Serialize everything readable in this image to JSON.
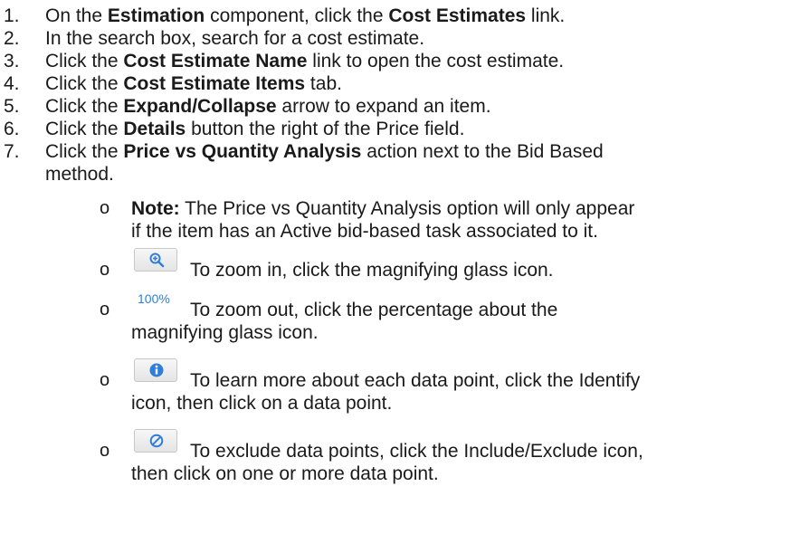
{
  "steps": [
    {
      "num": "1.",
      "parts": [
        "On the ",
        "Estimation",
        " component, click the ",
        "Cost Estimates",
        " link."
      ]
    },
    {
      "num": "2.",
      "text": "In the search box, search for a cost estimate."
    },
    {
      "num": "3.",
      "parts": [
        "Click the ",
        "Cost Estimate Name",
        " link to open the cost estimate."
      ]
    },
    {
      "num": "4.",
      "parts": [
        "Click the ",
        "Cost Estimate Items",
        " tab."
      ]
    },
    {
      "num": "5.",
      "parts": [
        "Click the ",
        "Expand/Collapse",
        " arrow to expand an item."
      ]
    },
    {
      "num": "6.",
      "parts": [
        "Click the ",
        "Details",
        " button the right of the Price field."
      ]
    },
    {
      "num": "7.",
      "parts": [
        "Click the ",
        "Price vs Quantity Analysis",
        " action next to the Bid Based"
      ],
      "cont": "method."
    }
  ],
  "bullets": {
    "mark": "o",
    "note": {
      "label": "Note:",
      "line1": " The Price vs Quantity Analysis option will only appear",
      "line2": "if the item has an Active bid-based task associated to it."
    },
    "zoom_in": {
      "text": "To zoom in, click the magnifying glass icon."
    },
    "zoom_out": {
      "percent": "100%",
      "line1": "To zoom out, click the percentage about the",
      "line2": "magnifying glass icon."
    },
    "identify": {
      "line1": "To learn more about each data point, click the Identify",
      "line2": "icon, then click on a data point."
    },
    "exclude": {
      "line1": "To exclude data points, click the Include/Exclude icon,",
      "line2": "then click on one or more data point."
    }
  },
  "colors": {
    "icon_blue": "#2f7fd8",
    "text": "#1a1a1a"
  }
}
